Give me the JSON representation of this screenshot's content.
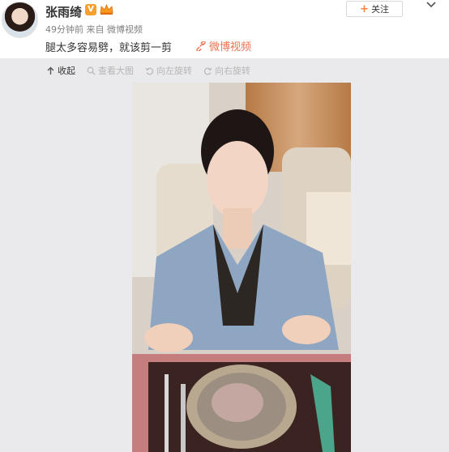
{
  "user": {
    "name": "张雨绮",
    "verified_badge": "V",
    "verified_color": "#f7a12c"
  },
  "post": {
    "time": "49分钟前",
    "source_prefix": "来自",
    "source": "微博视频",
    "text": "腿太多容易劈，就该剪一剪",
    "video_link": "微博视频",
    "link_color": "#eb7350"
  },
  "follow_button": {
    "label": "关注"
  },
  "toolbar": {
    "collapse": "收起",
    "view_large": "查看大图",
    "rotate_left": "向左旋转",
    "rotate_right": "向右旋转"
  },
  "icons": [
    "avatar",
    "vip-crown-icon",
    "chevron-down-icon",
    "plus-icon",
    "video-link-icon",
    "collapse-icon",
    "zoom-icon",
    "rotate-left-icon",
    "rotate-right-icon"
  ]
}
